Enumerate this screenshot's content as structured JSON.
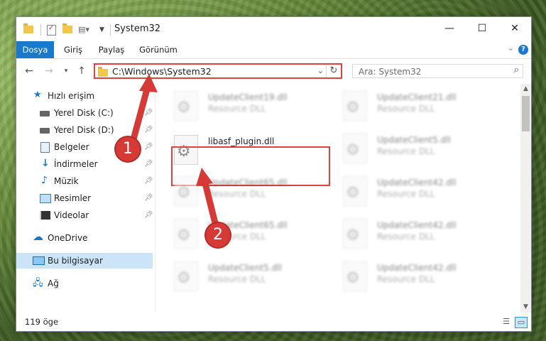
{
  "window": {
    "title": "System32",
    "controls": {
      "minimize": "—",
      "maximize": "☐",
      "close": "✕"
    }
  },
  "ribbon": {
    "tabs": [
      {
        "label": "Dosya",
        "active": true
      },
      {
        "label": "Giriş"
      },
      {
        "label": "Paylaş"
      },
      {
        "label": "Görünüm"
      }
    ],
    "help": "?"
  },
  "address": {
    "path": "C:\\Windows\\System32",
    "search_placeholder": "Ara: System32"
  },
  "sidebar": {
    "items": [
      {
        "label": "Hızlı erişim",
        "icon": "star-icon"
      },
      {
        "label": "Yerel Disk (C:)",
        "icon": "drive-icon",
        "pinned": true
      },
      {
        "label": "Yerel Disk (D:)",
        "icon": "drive-icon",
        "pinned": true
      },
      {
        "label": "Belgeler",
        "icon": "document-icon",
        "pinned": true
      },
      {
        "label": "İndirmeler",
        "icon": "download-icon",
        "pinned": true
      },
      {
        "label": "Müzik",
        "icon": "music-icon",
        "pinned": true
      },
      {
        "label": "Resimler",
        "icon": "pictures-icon",
        "pinned": true
      },
      {
        "label": "Videolar",
        "icon": "videos-icon",
        "pinned": true
      },
      {
        "label": "OneDrive",
        "icon": "cloud-icon"
      },
      {
        "label": "Bu bilgisayar",
        "icon": "computer-icon",
        "selected": true
      },
      {
        "label": "Ağ",
        "icon": "network-icon"
      }
    ]
  },
  "files": [
    {
      "name": "UpdateClient19.dll",
      "type": "Resource DLL",
      "blurred": true
    },
    {
      "name": "UpdateClient21.dll",
      "type": "Resource DLL",
      "blurred": true
    },
    {
      "name": "libasf_plugin.dll",
      "type": "",
      "blurred": false,
      "highlighted": true
    },
    {
      "name": "UpdateClient5.dll",
      "type": "Resource DLL",
      "blurred": true
    },
    {
      "name": "UpdateClient65.dll",
      "type": "Resource DLL",
      "blurred": true
    },
    {
      "name": "UpdateClient42.dll",
      "type": "Resource DLL",
      "blurred": true
    },
    {
      "name": "UpdateClient65.dll",
      "type": "Resource DLL",
      "blurred": true
    },
    {
      "name": "UpdateClient42.dll",
      "type": "Resource DLL",
      "blurred": true
    },
    {
      "name": "UpdateClient5.dll",
      "type": "Resource DLL",
      "blurred": true
    },
    {
      "name": "UpdateClient42.dll",
      "type": "Resource DLL",
      "blurred": true
    }
  ],
  "status": {
    "item_count": "119 öge"
  },
  "annotations": {
    "step1": "1",
    "step2": "2",
    "color": "#d63a36"
  }
}
